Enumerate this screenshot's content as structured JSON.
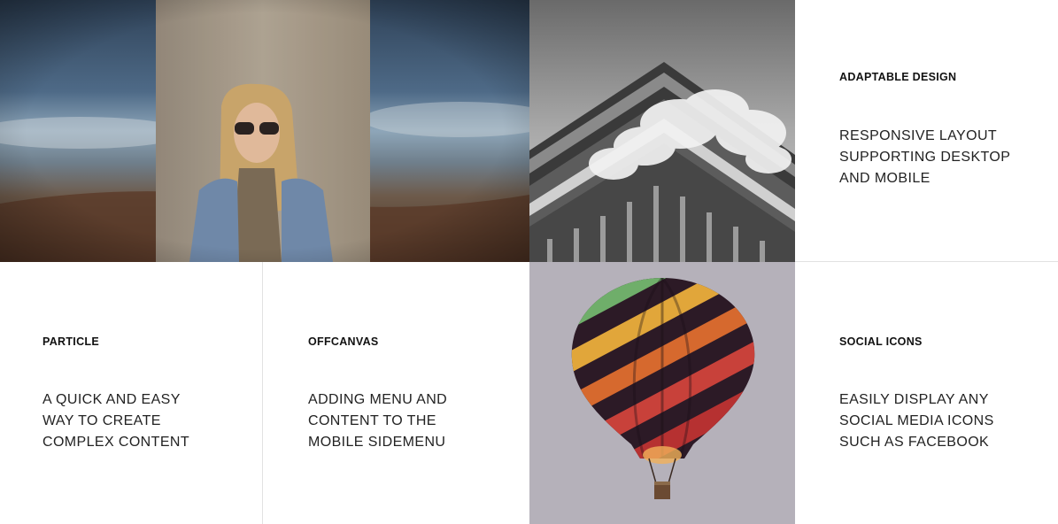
{
  "features": {
    "adaptable": {
      "title": "ADAPTABLE DESIGN",
      "description": "RESPONSIVE LAYOUT SUPPORTING DESKTOP AND MOBILE"
    },
    "particle": {
      "title": "PARTICLE",
      "description": "A QUICK AND EASY WAY TO CREATE COMPLEX CONTENT"
    },
    "offcanvas": {
      "title": "OFFCANVAS",
      "description": "ADDING MENU AND CONTENT TO THE MOBILE SIDEMENU"
    },
    "social": {
      "title": "SOCIAL ICONS",
      "description": "EASILY DISPLAY ANY SOCIAL MEDIA ICONS SUCH AS FACEBOOK"
    }
  },
  "images": {
    "portrait": "woman-portrait-image",
    "building": "building-image",
    "balloon": "hot-air-balloon-image"
  },
  "colors": {
    "divider": "#e2e2e2",
    "balloon_bg": "#b5b1ba",
    "text": "#222222"
  }
}
